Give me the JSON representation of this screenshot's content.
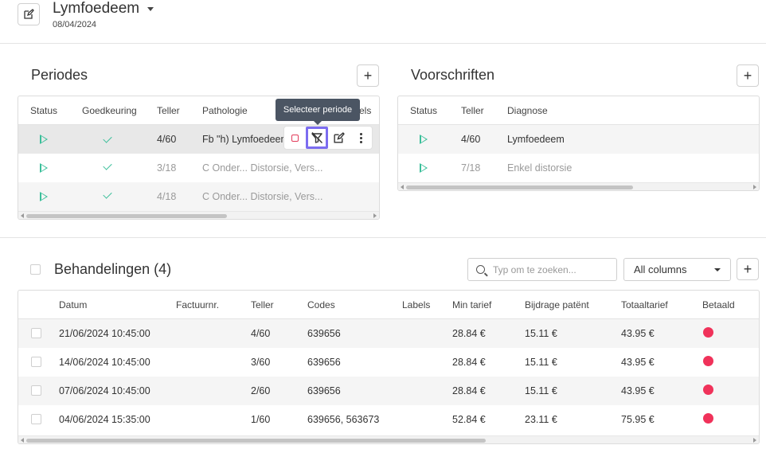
{
  "header": {
    "title": "Lymfoedeem",
    "date": "08/04/2024"
  },
  "periodes": {
    "title": "Periodes",
    "add_label": "+",
    "columns": [
      "Status",
      "Goedkeuring",
      "Teller",
      "Pathologie",
      "els"
    ],
    "rows": [
      {
        "teller": "4/60",
        "pathologie": "Fb \"h) Lymfoedeem"
      },
      {
        "teller": "3/18",
        "pathologie": "C Onder... Distorsie, Vers..."
      },
      {
        "teller": "4/18",
        "pathologie": "C Onder... Distorsie, Vers..."
      }
    ],
    "tooltip": "Selecteer periode",
    "actions": [
      "stop-icon",
      "filter-off-icon",
      "edit-icon",
      "more-icon"
    ]
  },
  "voorschriften": {
    "title": "Voorschriften",
    "add_label": "+",
    "columns": [
      "Status",
      "Teller",
      "Diagnose"
    ],
    "rows": [
      {
        "teller": "4/60",
        "diagnose": "Lymfoedeem"
      },
      {
        "teller": "7/18",
        "diagnose": "Enkel distorsie"
      }
    ]
  },
  "behandelingen": {
    "title": "Behandelingen (4)",
    "search_placeholder": "Typ om te zoeken...",
    "filter_value": "All columns",
    "add_label": "+",
    "columns": [
      "Datum",
      "Factuurnr.",
      "Teller",
      "Codes",
      "Labels",
      "Min tarief",
      "Bijdrage patënt",
      "Totaaltarief",
      "Betaald"
    ],
    "rows": [
      {
        "datum": "21/06/2024 10:45:00",
        "teller": "4/60",
        "codes": "639656",
        "min": "28.84 €",
        "bijdrage": "15.11 €",
        "totaal": "43.95 €"
      },
      {
        "datum": "14/06/2024 10:45:00",
        "teller": "3/60",
        "codes": "639656",
        "min": "28.84 €",
        "bijdrage": "15.11 €",
        "totaal": "43.95 €"
      },
      {
        "datum": "07/06/2024 10:45:00",
        "teller": "2/60",
        "codes": "639656",
        "min": "28.84 €",
        "bijdrage": "15.11 €",
        "totaal": "43.95 €"
      },
      {
        "datum": "04/06/2024 15:35:00",
        "teller": "1/60",
        "codes": "639656, 563673",
        "min": "52.84 €",
        "bijdrage": "23.11 €",
        "totaal": "75.95 €"
      }
    ],
    "paid_color": "#f0325a"
  },
  "accent_colors": {
    "status_green": "#3bbf9a",
    "focus_purple": "#7b6cf0"
  }
}
